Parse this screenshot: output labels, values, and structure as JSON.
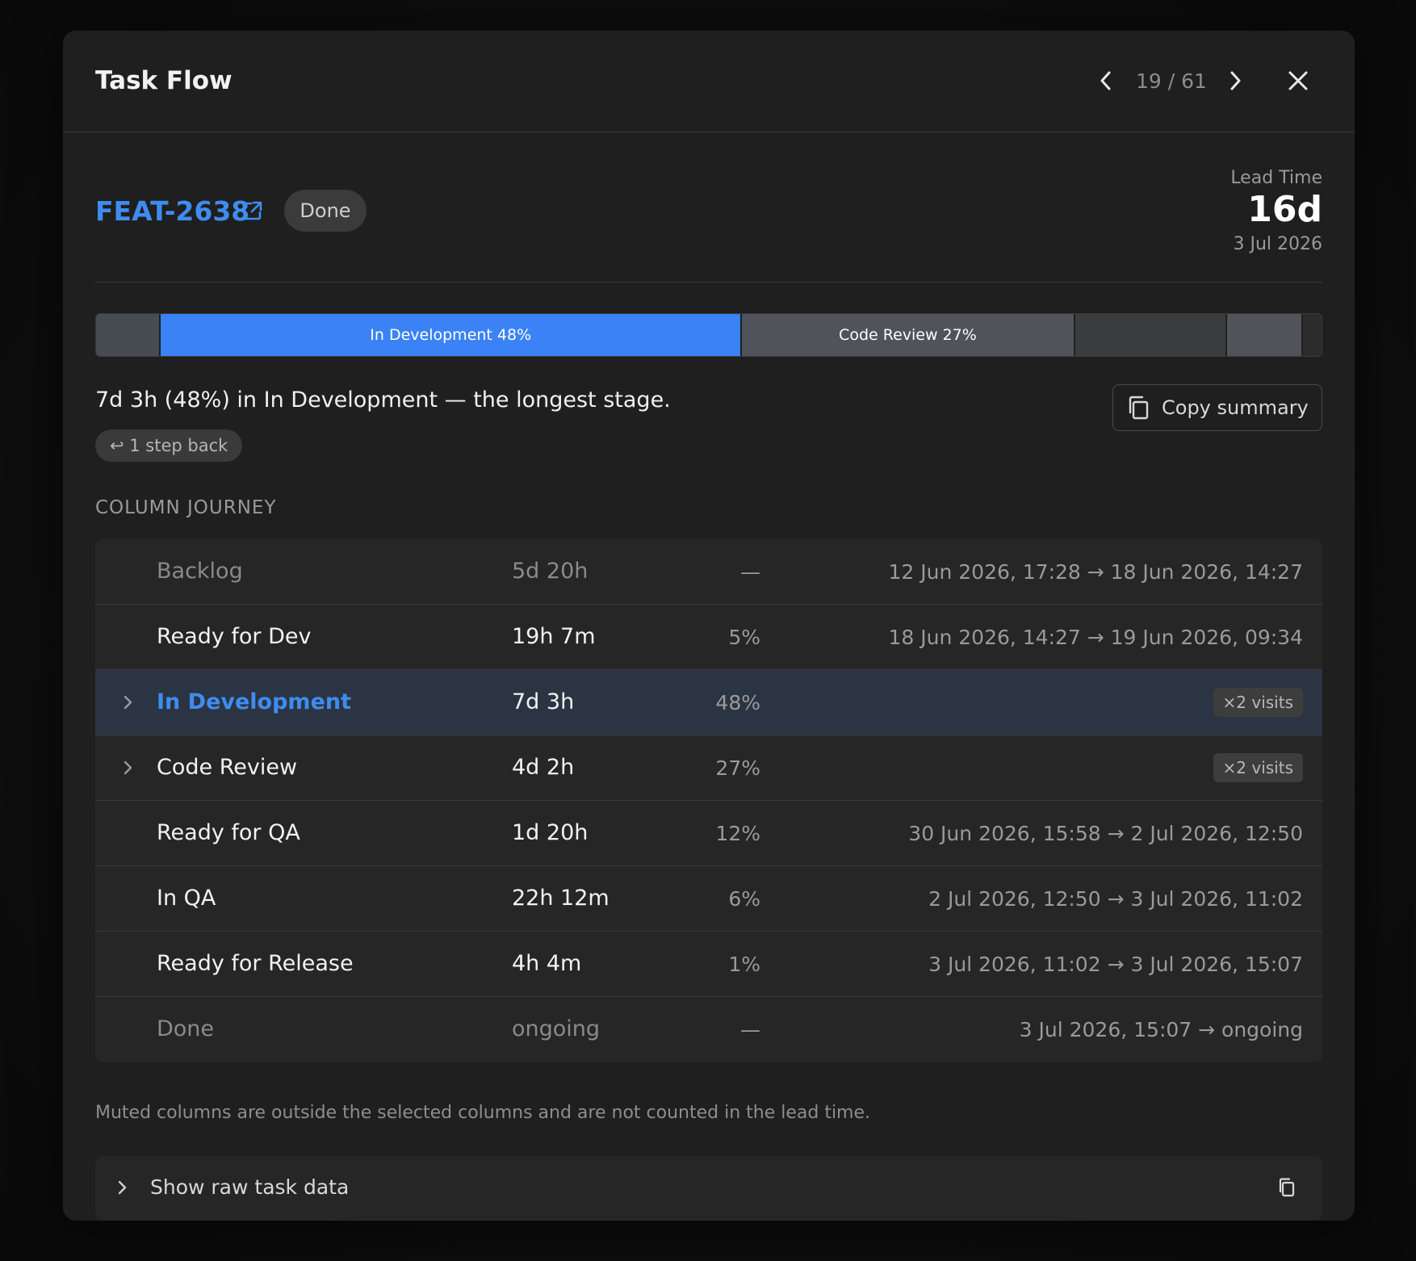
{
  "header": {
    "title": "Task Flow",
    "pager": "19 / 61"
  },
  "task": {
    "id": "FEAT-2638",
    "status": "Done",
    "lead_time_label": "Lead Time",
    "lead_time_value": "16d",
    "lead_time_date": "3 Jul 2026"
  },
  "stage_bar": {
    "segments": [
      {
        "label": "",
        "share": 0.053,
        "tone": "muted"
      },
      {
        "label": "In Development 48%",
        "share": 0.474,
        "tone": "blue"
      },
      {
        "label": "Code Review 27%",
        "share": 0.272,
        "tone": "grey"
      },
      {
        "label": "",
        "share": 0.124,
        "tone": "dark"
      },
      {
        "label": "",
        "share": 0.062,
        "tone": "grey"
      },
      {
        "label": "",
        "share": 0.015,
        "tone": "tail"
      }
    ]
  },
  "summary": {
    "text": "7d 3h (48%) in In Development — the longest stage.",
    "step_back": "↩ 1 step back",
    "copy_label": "Copy summary"
  },
  "journey": {
    "heading": "COLUMN JOURNEY",
    "rows": [
      {
        "name": "Backlog",
        "duration": "5d 20h",
        "pct": "—",
        "range": "12 Jun 2026, 17:28 → 18 Jun 2026, 14:27"
      },
      {
        "name": "Ready for Dev",
        "duration": "19h 7m",
        "pct": "5%",
        "range": "18 Jun 2026, 14:27 → 19 Jun 2026, 09:34"
      },
      {
        "name": "In Development",
        "duration": "7d 3h",
        "pct": "48%",
        "visits": "×2 visits"
      },
      {
        "name": "Code Review",
        "duration": "4d 2h",
        "pct": "27%",
        "visits": "×2 visits"
      },
      {
        "name": "Ready for QA",
        "duration": "1d 20h",
        "pct": "12%",
        "range": "30 Jun 2026, 15:58 → 2 Jul 2026, 12:50"
      },
      {
        "name": "In QA",
        "duration": "22h 12m",
        "pct": "6%",
        "range": "2 Jul 2026, 12:50 → 3 Jul 2026, 11:02"
      },
      {
        "name": "Ready for Release",
        "duration": "4h 4m",
        "pct": "1%",
        "range": "3 Jul 2026, 11:02 → 3 Jul 2026, 15:07"
      },
      {
        "name": "Done",
        "duration": "ongoing",
        "pct": "—",
        "range": "3 Jul 2026, 15:07 → ongoing"
      }
    ],
    "footnote": "Muted columns are outside the selected columns and are not counted in the lead time."
  },
  "raw_data": {
    "label": "Show raw task data"
  },
  "colors": {
    "accent": "#3f8cf0",
    "bar_blue": "#3b82f6",
    "surface": "#1f1f1f",
    "row_highlight": "#2b3442"
  }
}
